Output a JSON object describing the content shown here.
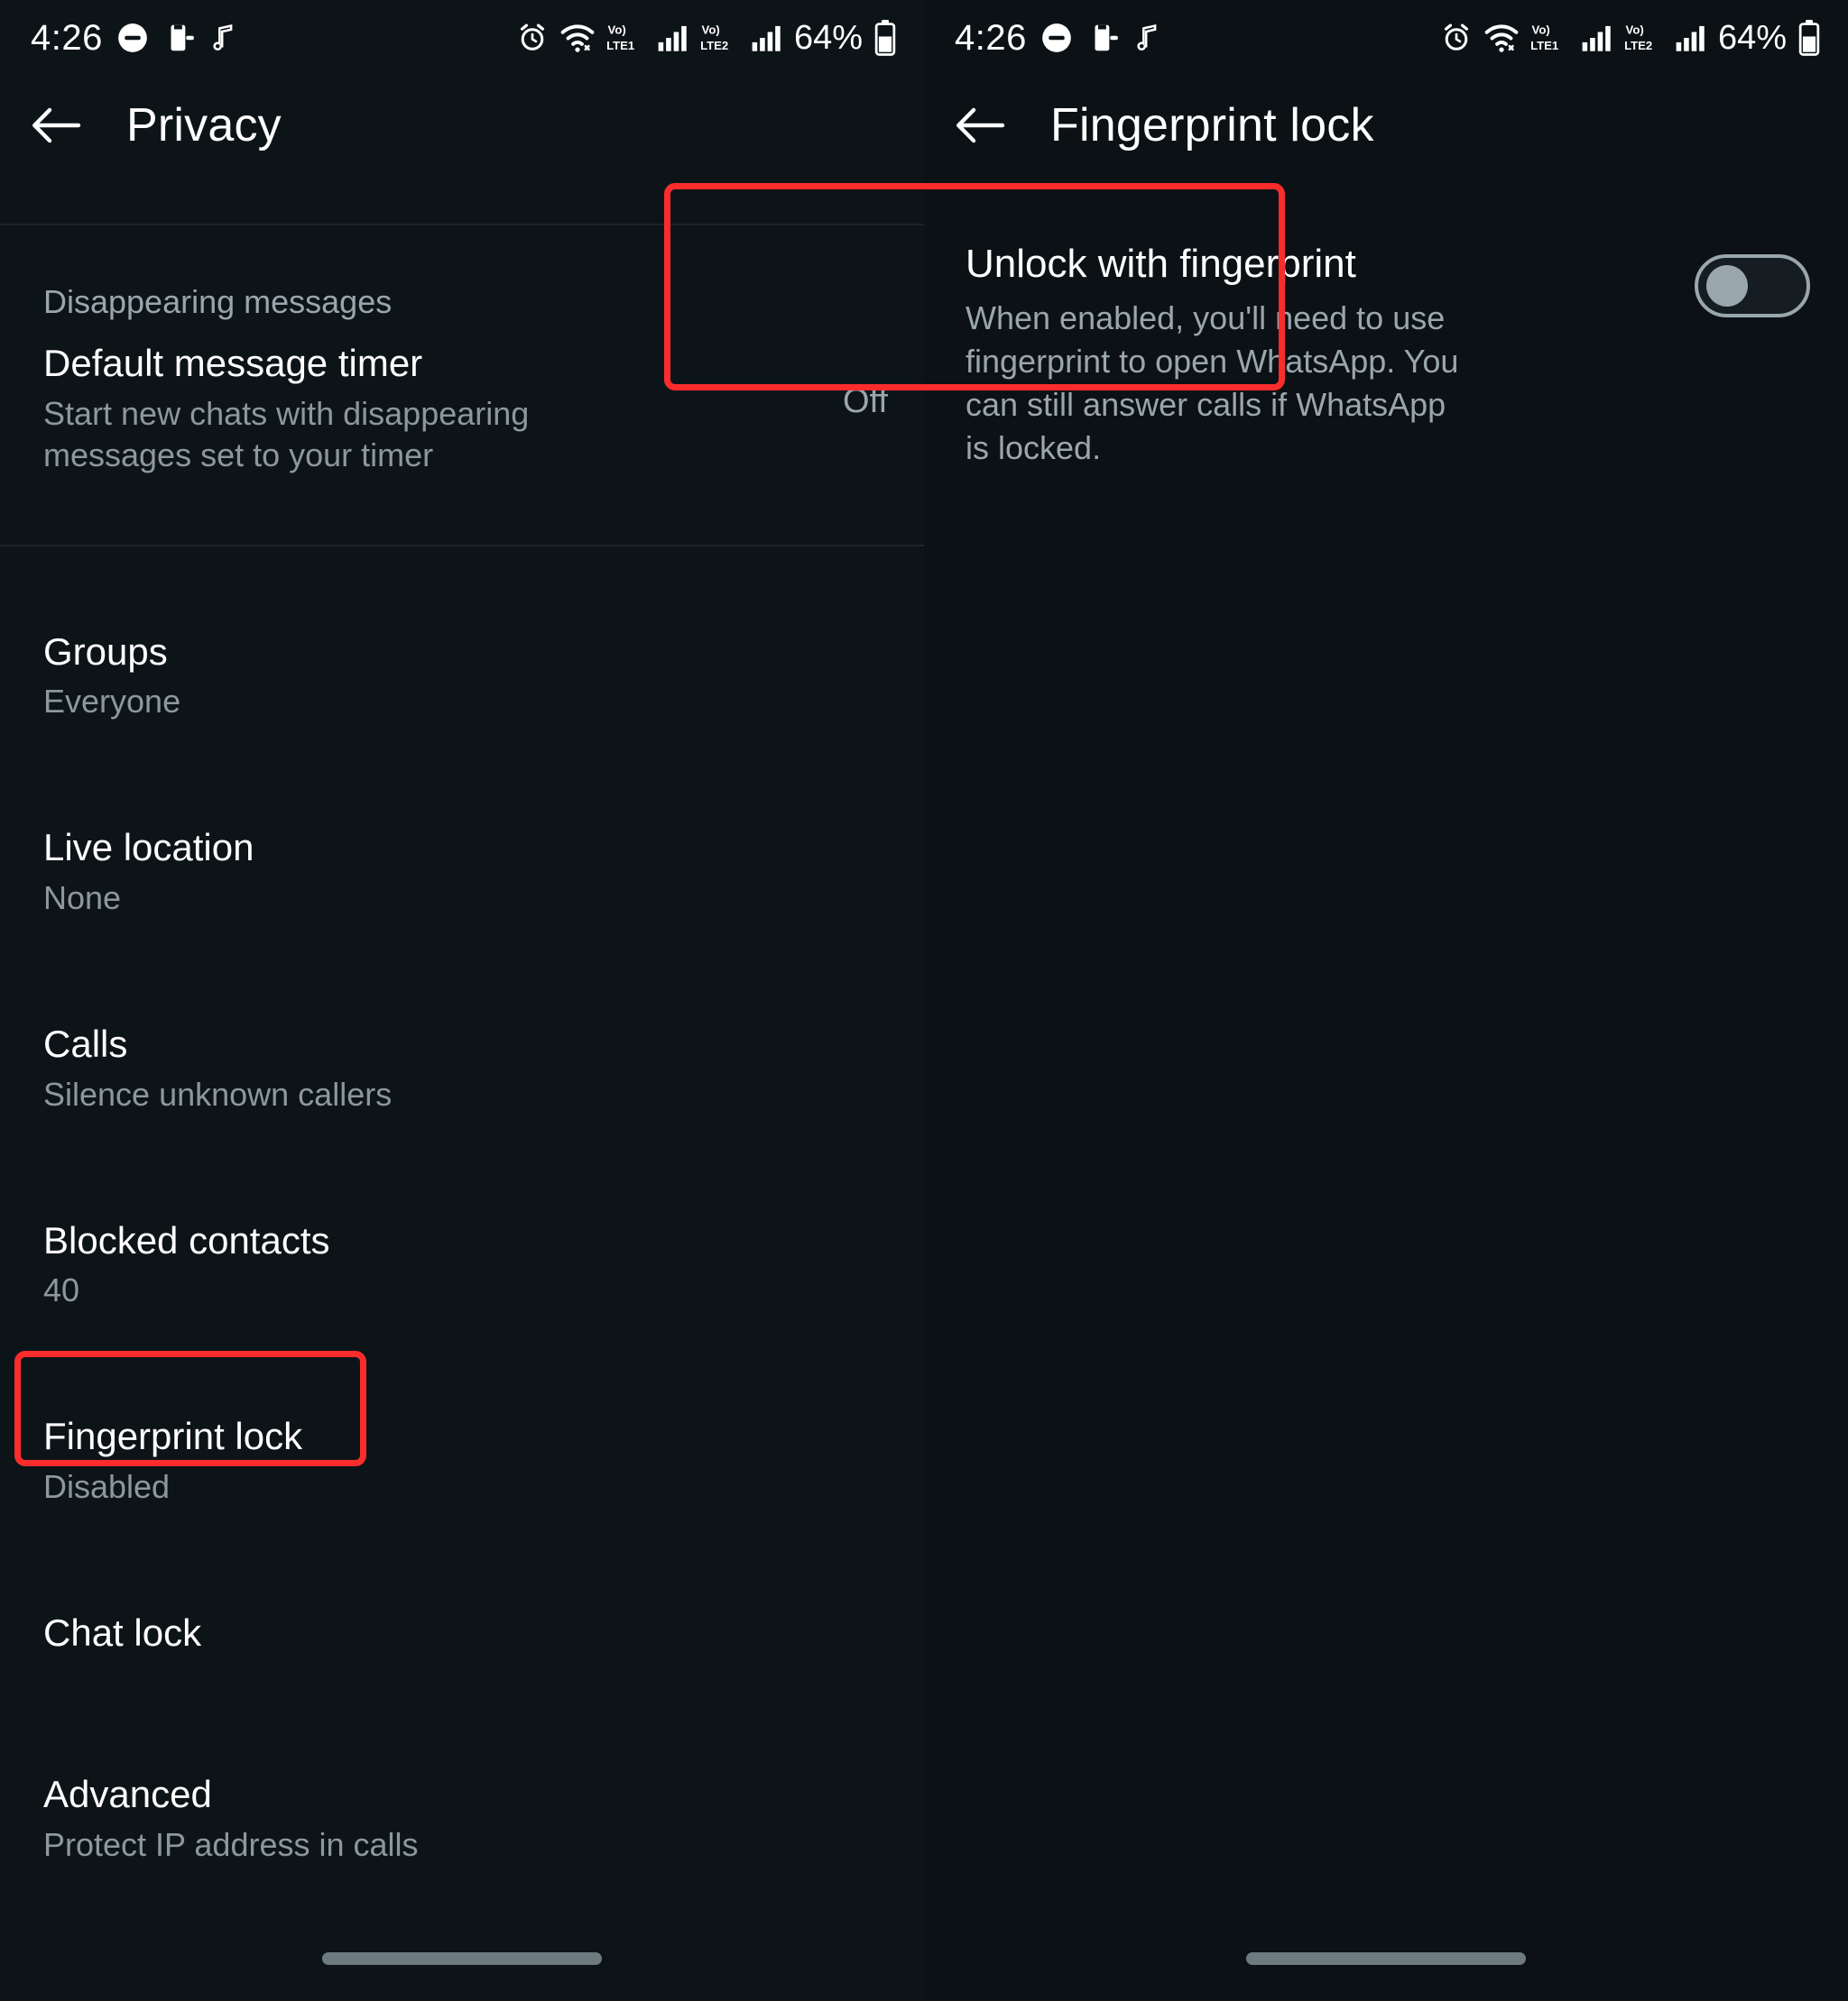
{
  "status_bar": {
    "time": "4:26",
    "battery_percent": "64%",
    "icons": [
      "dnd-icon",
      "screen-cast-icon",
      "music-note-icon",
      "alarm-icon",
      "wifi-icon",
      "volte-sim1-icon",
      "signal-sim1-icon",
      "volte-sim2-icon",
      "signal-sim2-icon",
      "battery-icon"
    ],
    "sim1_label": "LTE1",
    "sim2_label": "LTE2",
    "volte_label": "Vo)"
  },
  "left_screen": {
    "appbar": {
      "back_icon": "back-arrow-icon",
      "title": "Privacy"
    },
    "section_label": "Disappearing messages",
    "rows": [
      {
        "name": "default-message-timer",
        "title": "Default message timer",
        "subtitle": "Start new chats with disappearing messages set to your timer",
        "value": "Off"
      },
      {
        "name": "groups",
        "title": "Groups",
        "subtitle": "Everyone",
        "value": ""
      },
      {
        "name": "live-location",
        "title": "Live location",
        "subtitle": "None",
        "value": ""
      },
      {
        "name": "calls",
        "title": "Calls",
        "subtitle": "Silence unknown callers",
        "value": ""
      },
      {
        "name": "blocked-contacts",
        "title": "Blocked contacts",
        "subtitle": "40",
        "value": ""
      },
      {
        "name": "fingerprint-lock",
        "title": "Fingerprint lock",
        "subtitle": "Disabled",
        "value": ""
      },
      {
        "name": "chat-lock",
        "title": "Chat lock",
        "subtitle": "",
        "value": ""
      },
      {
        "name": "advanced",
        "title": "Advanced",
        "subtitle": "Protect IP address in calls",
        "value": ""
      }
    ]
  },
  "right_screen": {
    "appbar": {
      "back_icon": "back-arrow-icon",
      "title": "Fingerprint lock"
    },
    "unlock_setting": {
      "title": "Unlock with fingerprint",
      "description": "When enabled, you'll need to use fingerprint to open WhatsApp. You can still answer calls if WhatsApp is locked.",
      "toggle_state": "off"
    }
  },
  "annotations": {
    "highlight_color": "#fb2c2c",
    "boxes": [
      {
        "name": "fingerprint-lock-row-highlight",
        "target": "Fingerprint lock"
      },
      {
        "name": "unlock-with-fingerprint-highlight",
        "target": "Unlock with fingerprint"
      }
    ]
  },
  "colors": {
    "background": "#0d1418",
    "text_primary": "#ffffff",
    "text_secondary": "#9aa6ad",
    "divider": "#1b2429",
    "accent_highlight": "#fb2c2c",
    "switch_track": "#9aa6ad"
  }
}
